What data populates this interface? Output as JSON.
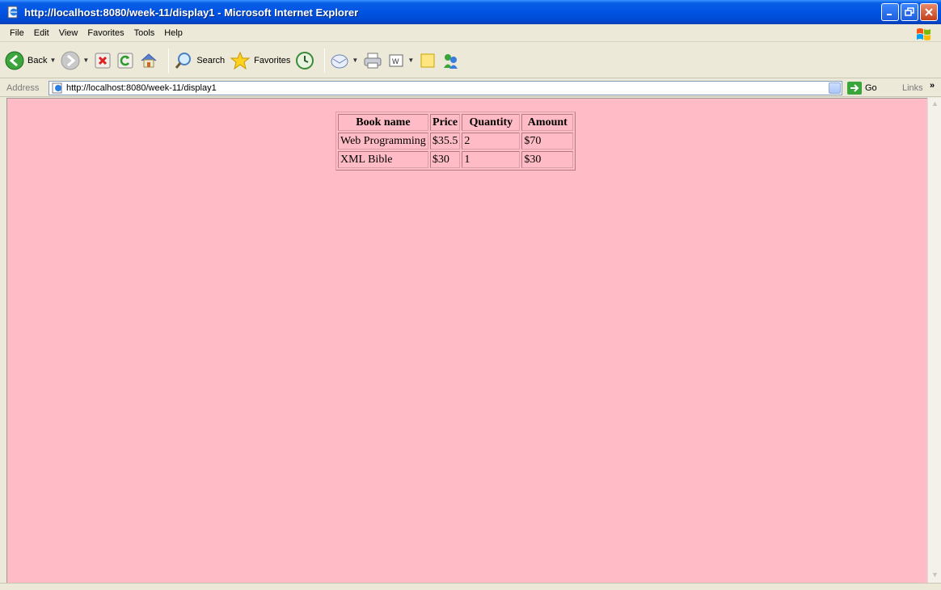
{
  "window": {
    "title": "http://localhost:8080/week-11/display1 - Microsoft Internet Explorer"
  },
  "menu": [
    "File",
    "Edit",
    "View",
    "Favorites",
    "Tools",
    "Help"
  ],
  "toolbar": {
    "back_label": "Back",
    "search_label": "Search",
    "favorites_label": "Favorites"
  },
  "address": {
    "label": "Address",
    "url": "http://localhost:8080/week-11/display1",
    "go_label": "Go",
    "links_label": "Links",
    "more": "»"
  },
  "colors": {
    "page_background": "#ffbcc6",
    "chrome": "#ece9d8",
    "titlebar": "#0054e3"
  },
  "table": {
    "headers": [
      "Book name",
      "Price",
      "Quantity",
      "Amount"
    ],
    "rows": [
      [
        "Web Programming",
        "$35.5",
        "2",
        "$70"
      ],
      [
        "XML Bible",
        "$30",
        "1",
        "$30"
      ]
    ]
  }
}
